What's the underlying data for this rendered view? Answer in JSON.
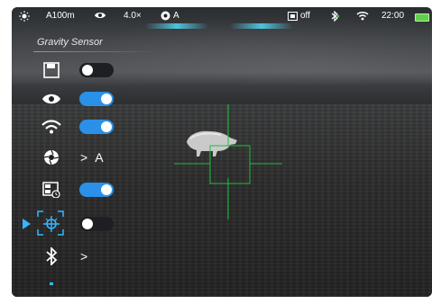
{
  "status": {
    "range": "A100m",
    "zoom": "4.0×",
    "calibration_mode": "A",
    "recording": "off",
    "time": "22:00"
  },
  "menu": {
    "title": "Gravity Sensor",
    "items": [
      {
        "name": "save",
        "icon": "save-icon",
        "control": "toggle",
        "state": "off"
      },
      {
        "name": "eye",
        "icon": "eye-icon",
        "control": "toggle",
        "state": "on"
      },
      {
        "name": "wifi",
        "icon": "wifi-icon",
        "control": "toggle",
        "state": "on"
      },
      {
        "name": "calibration",
        "icon": "aperture-icon",
        "control": "submenu",
        "value": "A"
      },
      {
        "name": "picture-in-picture",
        "icon": "pip-icon",
        "control": "toggle",
        "state": "on"
      },
      {
        "name": "gravity-sensor",
        "icon": "gravity-sensor-icon",
        "control": "toggle",
        "state": "off",
        "selected": true
      },
      {
        "name": "bluetooth",
        "icon": "bluetooth-icon",
        "control": "submenu"
      }
    ],
    "chevron": ">"
  },
  "colors": {
    "accent": "#37b6ff",
    "toggle_on": "#2a90e8",
    "reticle": "#1fbf3a",
    "battery": "#5fd04a"
  }
}
